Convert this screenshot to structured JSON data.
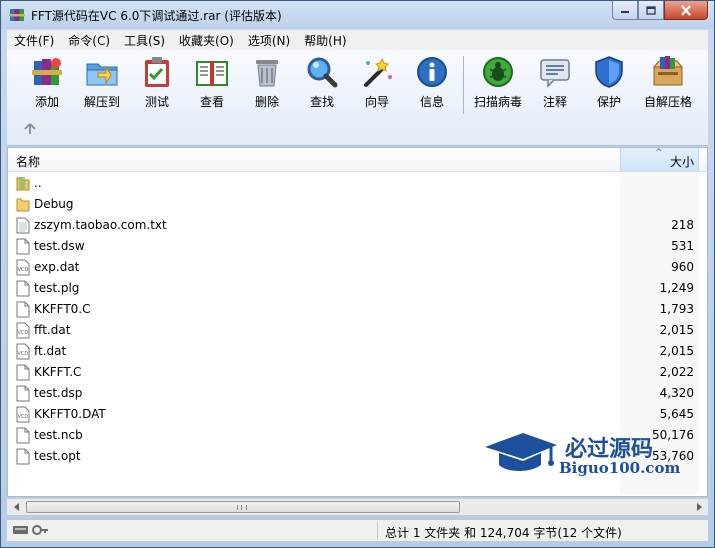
{
  "window": {
    "title": "FFT源代码在VC  6.0下调试通过.rar (评估版本)"
  },
  "menu": [
    {
      "label": "文件(F)"
    },
    {
      "label": "命令(C)"
    },
    {
      "label": "工具(S)"
    },
    {
      "label": "收藏夹(O)"
    },
    {
      "label": "选项(N)"
    },
    {
      "label": "帮助(H)"
    }
  ],
  "toolbar": {
    "buttons": [
      {
        "label": "添加",
        "icon": "add-books-icon"
      },
      {
        "label": "解压到",
        "icon": "extract-folder-icon"
      },
      {
        "label": "测试",
        "icon": "test-clipboard-icon"
      },
      {
        "label": "查看",
        "icon": "view-book-icon"
      },
      {
        "label": "删除",
        "icon": "trash-icon"
      },
      {
        "label": "查找",
        "icon": "magnifier-icon"
      },
      {
        "label": "向导",
        "icon": "wizard-wand-icon"
      },
      {
        "label": "信息",
        "icon": "info-icon"
      },
      {
        "label": "扫描病毒",
        "icon": "virus-scan-icon"
      },
      {
        "label": "注释",
        "icon": "comment-icon"
      },
      {
        "label": "保护",
        "icon": "shield-icon"
      },
      {
        "label": "自解压格",
        "icon": "sfx-box-icon"
      }
    ]
  },
  "list": {
    "columns": {
      "name": "名称",
      "size": "大小"
    },
    "rows": [
      {
        "name": "..",
        "size": "",
        "icon": "parent-folder-icon"
      },
      {
        "name": "Debug",
        "size": "",
        "icon": "folder-icon"
      },
      {
        "name": "zszym.taobao.com.txt",
        "size": "218",
        "icon": "text-file-icon"
      },
      {
        "name": "test.dsw",
        "size": "531",
        "icon": "file-icon"
      },
      {
        "name": "exp.dat",
        "size": "960",
        "icon": "vcd-file-icon"
      },
      {
        "name": "test.plg",
        "size": "1,249",
        "icon": "file-icon"
      },
      {
        "name": "KKFFT0.C",
        "size": "1,793",
        "icon": "file-icon"
      },
      {
        "name": "fft.dat",
        "size": "2,015",
        "icon": "vcd-file-icon"
      },
      {
        "name": "ft.dat",
        "size": "2,015",
        "icon": "vcd-file-icon"
      },
      {
        "name": "KKFFT.C",
        "size": "2,022",
        "icon": "file-icon"
      },
      {
        "name": "test.dsp",
        "size": "4,320",
        "icon": "file-icon"
      },
      {
        "name": "KKFFT0.DAT",
        "size": "5,645",
        "icon": "vcd-file-icon"
      },
      {
        "name": "test.ncb",
        "size": "50,176",
        "icon": "file-icon"
      },
      {
        "name": "test.opt",
        "size": "53,760",
        "icon": "file-icon"
      }
    ]
  },
  "status": {
    "text": "总计 1 文件夹 和 124,704 字节(12 个文件)"
  },
  "watermark": {
    "title": "必过源码",
    "url": "Biguo100.com"
  },
  "colors": {
    "accent": "#1c4f9c",
    "title_bar": "#c9daf0"
  }
}
